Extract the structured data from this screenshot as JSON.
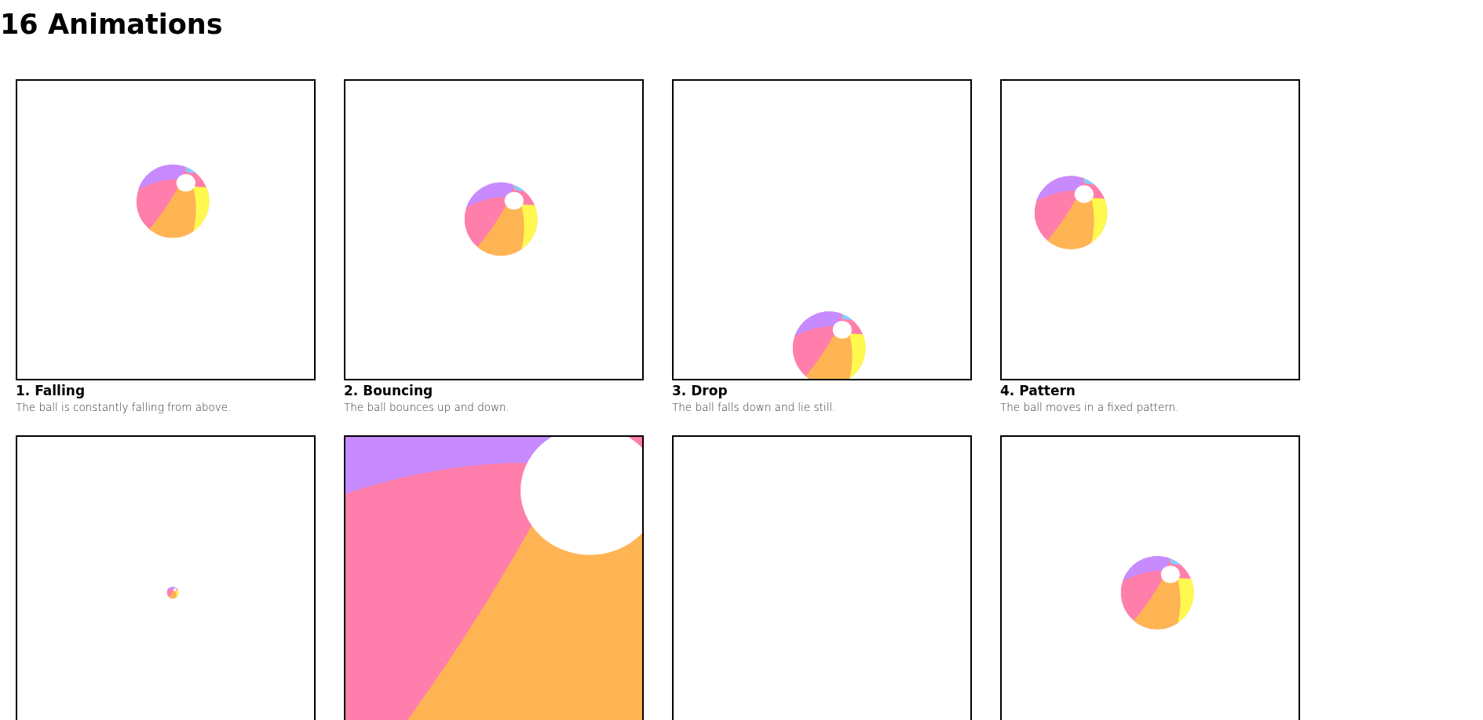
{
  "title": "16 Animations",
  "animations": [
    {
      "kind": "ball",
      "name": "1. Falling",
      "description": "The ball is constantly falling from above."
    },
    {
      "kind": "ball",
      "name": "2. Bouncing",
      "description": "The ball bounces up and down."
    },
    {
      "kind": "ball",
      "name": "3. Drop",
      "description": "The ball falls down and lie still."
    },
    {
      "kind": "ball",
      "name": "4. Pattern",
      "description": "The ball moves in a fixed pattern."
    },
    {
      "kind": "ball"
    },
    {
      "kind": "ball"
    },
    {
      "kind": "blank"
    },
    {
      "kind": "ball"
    }
  ]
}
